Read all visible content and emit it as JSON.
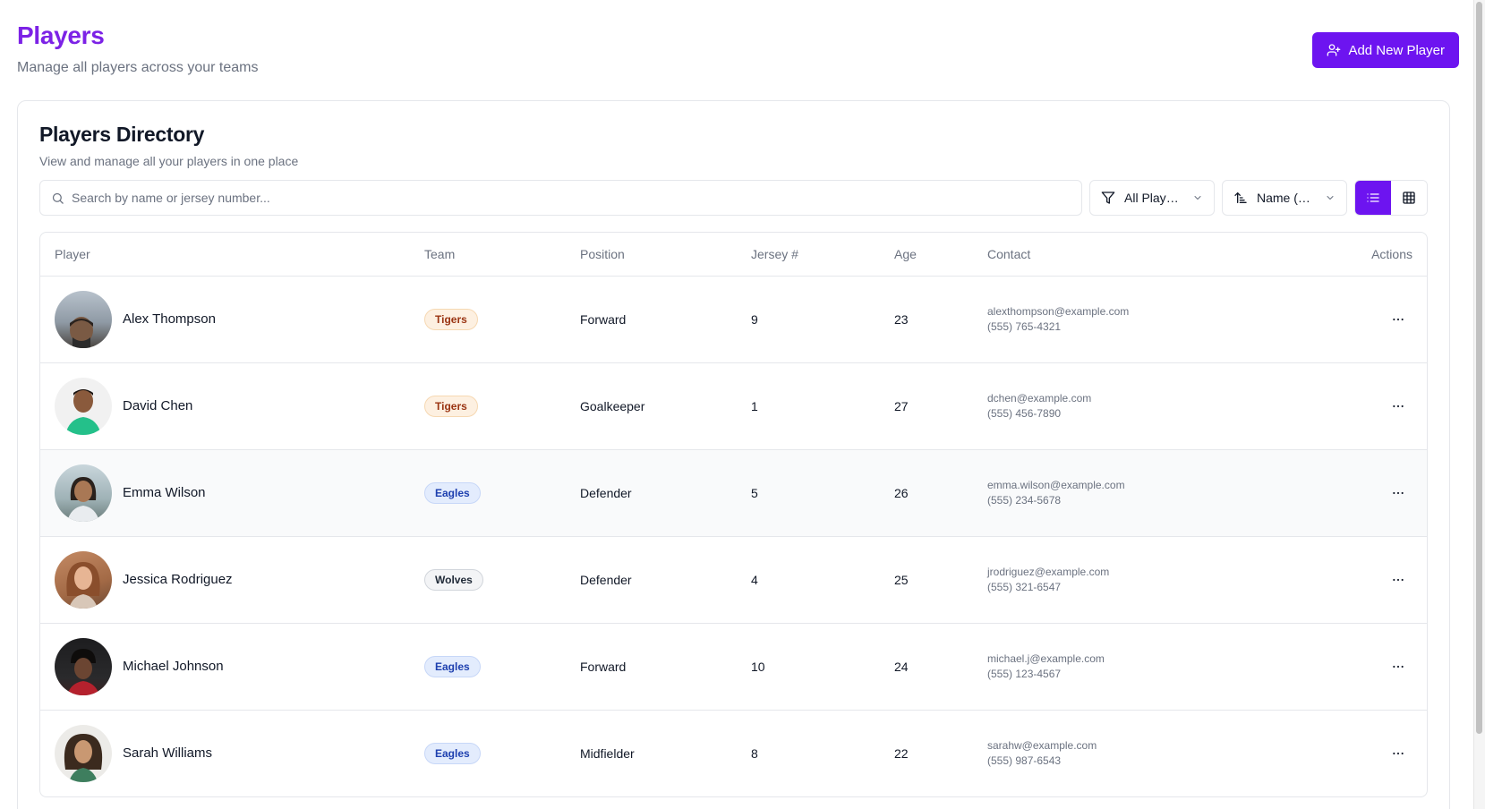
{
  "header": {
    "title": "Players",
    "subtitle": "Manage all players across your teams",
    "add_button_label": "Add New Player"
  },
  "directory": {
    "title": "Players Directory",
    "subtitle": "View and manage all your players in one place"
  },
  "toolbar": {
    "search_placeholder": "Search by name or jersey number...",
    "search_value": "",
    "filter_label": "All Players",
    "sort_label": "Name (A-Z)",
    "active_view": "list"
  },
  "table": {
    "columns": {
      "player": "Player",
      "team": "Team",
      "position": "Position",
      "jersey": "Jersey #",
      "age": "Age",
      "contact": "Contact",
      "actions": "Actions"
    },
    "rows": [
      {
        "name": "Alex Thompson",
        "team": "Tigers",
        "position": "Forward",
        "jersey": "9",
        "age": "23",
        "email": "alexthompson@example.com",
        "phone": "(555) 765-4321"
      },
      {
        "name": "David Chen",
        "team": "Tigers",
        "position": "Goalkeeper",
        "jersey": "1",
        "age": "27",
        "email": "dchen@example.com",
        "phone": "(555) 456-7890"
      },
      {
        "name": "Emma Wilson",
        "team": "Eagles",
        "position": "Defender",
        "jersey": "5",
        "age": "26",
        "email": "emma.wilson@example.com",
        "phone": "(555) 234-5678"
      },
      {
        "name": "Jessica Rodriguez",
        "team": "Wolves",
        "position": "Defender",
        "jersey": "4",
        "age": "25",
        "email": "jrodriguez@example.com",
        "phone": "(555) 321-6547"
      },
      {
        "name": "Michael Johnson",
        "team": "Eagles",
        "position": "Forward",
        "jersey": "10",
        "age": "24",
        "email": "michael.j@example.com",
        "phone": "(555) 123-4567"
      },
      {
        "name": "Sarah Williams",
        "team": "Eagles",
        "position": "Midfielder",
        "jersey": "8",
        "age": "22",
        "email": "sarahw@example.com",
        "phone": "(555) 987-6543"
      }
    ]
  },
  "colors": {
    "accent": "#6d14f0",
    "title_purple": "#7c22e6",
    "tigers_badge_bg": "#fdf0e1",
    "tigers_badge_text": "#9a3412",
    "eagles_badge_bg": "#e3ecfd",
    "eagles_badge_text": "#1e40af",
    "wolves_badge_bg": "#f3f4f6",
    "wolves_badge_text": "#1f2937"
  },
  "icons": {
    "add_button": "user-plus-icon",
    "search": "search-icon",
    "filter": "filter-icon",
    "sort": "sort-icon",
    "dropdown": "chevron-down-icon",
    "list_view": "list-icon",
    "grid_view": "grid-icon",
    "row_actions": "more-horizontal-icon"
  }
}
